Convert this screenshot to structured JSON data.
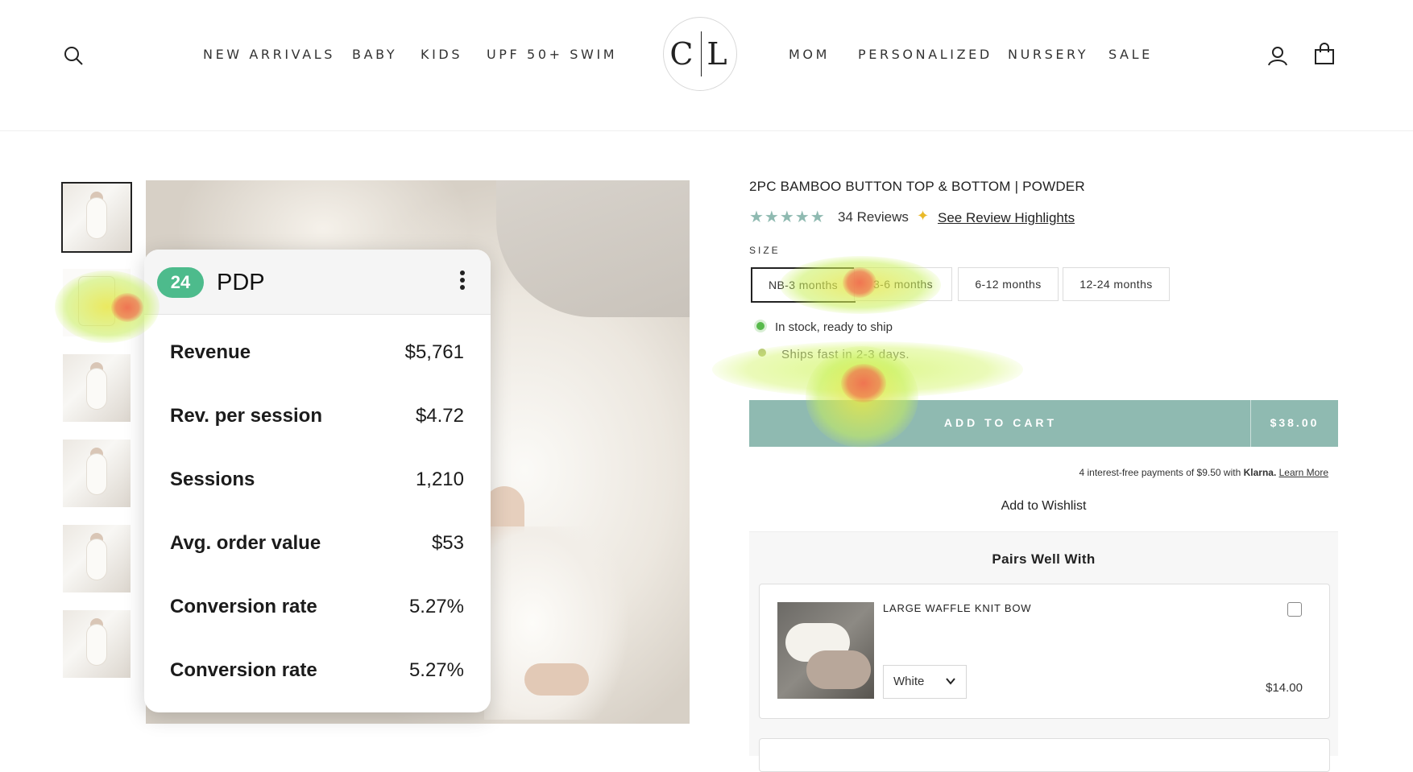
{
  "header": {
    "nav_left": [
      "NEW ARRIVALS",
      "BABY",
      "KIDS",
      "UPF 50+ SWIM"
    ],
    "nav_right": [
      "MOM",
      "PERSONALIZED",
      "NURSERY",
      "SALE"
    ],
    "logo_text": "C L",
    "icons": [
      "search-icon",
      "account-icon",
      "cart-icon"
    ]
  },
  "overlay": {
    "badge": "24",
    "title": "PDP",
    "metrics": [
      {
        "label": "Revenue",
        "value": "$5,761"
      },
      {
        "label": "Rev. per session",
        "value": "$4.72"
      },
      {
        "label": "Sessions",
        "value": "1,210"
      },
      {
        "label": "Avg. order value",
        "value": "$53"
      },
      {
        "label": "Conversion rate",
        "value": "5.27%"
      },
      {
        "label": "Conversion rate",
        "value": "5.27%"
      }
    ]
  },
  "product": {
    "title": "2PC BAMBOO BUTTON TOP & BOTTOM | POWDER",
    "stars": "★★★★★",
    "rating": 5,
    "reviews": "34 Reviews",
    "review_highlights": "See Review Highlights",
    "size_label": "SIZE",
    "sizes": [
      "NB-3 months",
      "3-6 months",
      "6-12 months",
      "12-24 months"
    ],
    "selected_size": "NB-3 months",
    "stock": "In stock, ready to ship",
    "shipping": "Ships fast in 2-3 days.",
    "add_to_cart": "ADD TO CART",
    "price": "$38.00",
    "klarna_text": "4 interest-free payments of $9.50 with",
    "klarna_brand": "Klarna.",
    "klarna_link": "Learn More",
    "wishlist": "Add to Wishlist"
  },
  "pairs": {
    "title": "Pairs Well With",
    "items": [
      {
        "name": "LARGE WAFFLE KNIT BOW",
        "option": "White",
        "price": "$14.00",
        "checked": false
      }
    ]
  },
  "colors": {
    "accent": "#8fbab1",
    "badge": "#4dbb8c",
    "in_stock": "#57b94b",
    "star": "#8fbab1",
    "sparkle": "#e9b928"
  }
}
